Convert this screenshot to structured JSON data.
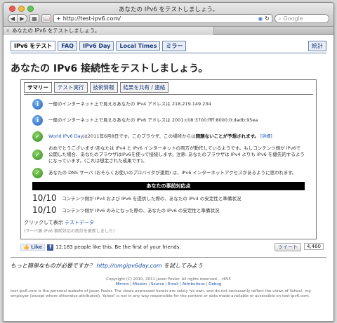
{
  "window": {
    "title": "あなたの IPv6 をテストしましょう。",
    "url": "http://test-ipv6.com/",
    "search_placeholder": "Google",
    "tab_label": "あなたの IPv6 をテストしましょう。"
  },
  "sitenav": {
    "items": [
      "IPv6 をテスト",
      "FAQ",
      "IPv6 Day",
      "Local Times",
      "ミラー"
    ],
    "stats": "統計"
  },
  "heading": "あなたの IPv6 接続性をテストしましょう。",
  "subtabs": [
    "サマリー",
    "テスト実行",
    "技術情報",
    "結果を共有 / 連絡"
  ],
  "results": {
    "ipv4": "一般のインターネット上で見えるあなたの IPv4 アドレスは 218.219.149.234",
    "ipv6": "一般のインターネット上で見えるあなたの IPv6 アドレスは 2001:c08:3700:ffff:8000:0:dadb:95ea",
    "day_link": "World IPv6 Day",
    "day_text": "は2011年6月8日です。このブラウザ、この場所からは",
    "day_bold": "問題ないことが予想されます。",
    "day_more": "[詳細]",
    "congrats": "おめでとうございます!あなたは IPv4 と IPv6 インターネットの両方が動作しているようです。もしコンテンツ側が IPv6で公開した場合、あなたのブラウザはIPv6を使って接続します。注意: あなたのブラウザは IPv4 よりも IPv6 を優先的するようになっています。(これは想定された成果です)。",
    "dns": "あなたの DNS サーバ (おそらくお使いのプロバイダが運用) は、IPv6 インターネットアクセスがあるように思われます。"
  },
  "readiness": {
    "header": "あなたの事前対応点",
    "scores": [
      {
        "value": "10/10",
        "text": "コンテンツ側が IPv4 および IPv6 を提供した際の、あなたの IPv4 の安定性と準備状況"
      },
      {
        "value": "10/10",
        "text": "コンテンツ側が IPv6 のみになった際の、あなたの IPv6 の安定性と準備状況"
      }
    ]
  },
  "testdata": {
    "prefix": "クリックして表示 ",
    "link": "テストデータ"
  },
  "note": "(サーバ側 IPv6 事前対応の統計を更新しました)",
  "social": {
    "like": "Like",
    "like_text": "12,183 people like this. Be the first of your friends.",
    "tweet": "ツイート",
    "tweet_count": "4,460"
  },
  "mobile": {
    "prefix": "もっと簡単なものが必要ですか？ ",
    "link": "http://omgipv6day.com",
    "suffix": " を試してみよう"
  },
  "footer": {
    "copyright": "Copyright (C) 2010, 2011 Jason Fesler. All rights reserved. - r655",
    "links": [
      "Mirrors",
      "Mission",
      "Source",
      "Email",
      "Attributions",
      "Debug"
    ],
    "disclaimer": "test-ipv6.com is the personal website of Jason Fesler. The views expressed herein are solely his own, and do not necessarily reflect the views of Yahoo!, my employer (except where otherwise attributed). Yahoo! is not in any way responsible for the content or data made available or accessible on test-ipv6.com."
  }
}
